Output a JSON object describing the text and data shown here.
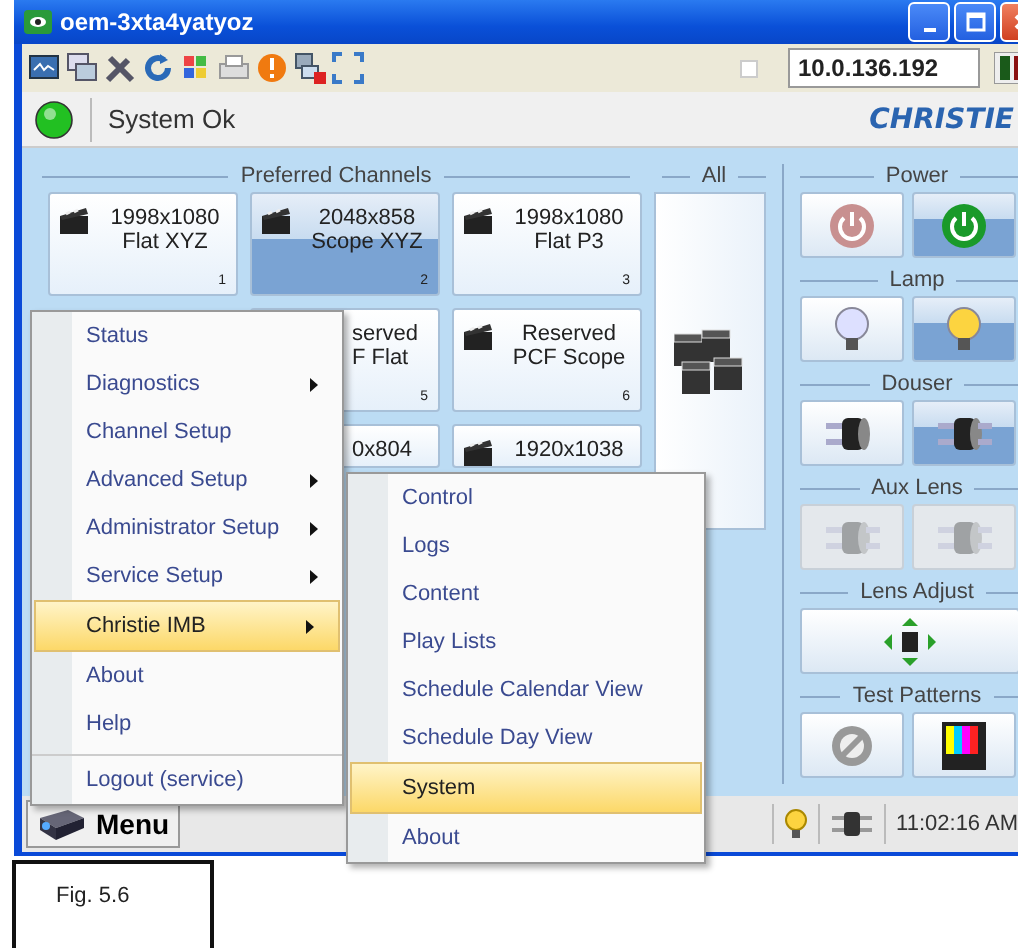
{
  "window": {
    "title": "oem-3xta4yatyoz"
  },
  "toolbar": {
    "address": "10.0.136.192",
    "checked": false
  },
  "status": {
    "text": "System Ok",
    "ok": true,
    "logo": "CHRISTIE"
  },
  "preferred_channels": {
    "title": "Preferred Channels",
    "rows": [
      [
        {
          "resolution": "1998x1080",
          "format": "Flat XYZ",
          "number": "1",
          "selected": false,
          "covered": false
        },
        {
          "resolution": "2048x858",
          "format": "Scope XYZ",
          "number": "2",
          "selected": true,
          "covered": false
        },
        {
          "resolution": "1998x1080",
          "format": "Flat P3",
          "number": "3",
          "selected": false,
          "covered": false
        }
      ],
      [
        "",
        {
          "resolution": "served",
          "format": "F Flat",
          "number": "5",
          "selected": false,
          "covered": true
        },
        {
          "resolution": "Reserved",
          "format": "PCF Scope",
          "number": "6",
          "selected": false,
          "covered": false
        }
      ],
      [
        "",
        {
          "resolution": "0x804",
          "selected": false,
          "covered": true
        },
        {
          "resolution": "1920x1038",
          "selected": false,
          "covered": false
        }
      ]
    ]
  },
  "all": {
    "title": "All"
  },
  "controls": [
    {
      "title": "Power",
      "buttons": [
        {
          "kind": "power-off",
          "selected": false,
          "disabled": false
        },
        {
          "kind": "power-on",
          "selected": true,
          "disabled": false
        }
      ]
    },
    {
      "title": "Lamp",
      "buttons": [
        {
          "kind": "bulb-off",
          "selected": false,
          "disabled": false
        },
        {
          "kind": "bulb-on",
          "selected": true,
          "disabled": false
        }
      ]
    },
    {
      "title": "Douser",
      "buttons": [
        {
          "kind": "douser-closed",
          "selected": false,
          "disabled": false
        },
        {
          "kind": "douser-open",
          "selected": true,
          "disabled": false
        }
      ]
    },
    {
      "title": "Aux Lens",
      "buttons": [
        {
          "kind": "lens-in",
          "selected": false,
          "disabled": true
        },
        {
          "kind": "lens-out",
          "selected": false,
          "disabled": true
        }
      ]
    },
    {
      "title": "Lens Adjust",
      "buttons": [
        {
          "kind": "lens-adjust",
          "selected": false,
          "disabled": false
        }
      ]
    },
    {
      "title": "Test Patterns",
      "buttons": [
        {
          "kind": "pattern-off",
          "selected": false,
          "disabled": false
        },
        {
          "kind": "pattern-bars",
          "selected": false,
          "disabled": false
        }
      ]
    }
  ],
  "bottom_bar": {
    "menu_label": "Menu",
    "time": "11:02:16 AM"
  },
  "menu": {
    "items": [
      {
        "label": "Status",
        "submenu": false,
        "selected": false,
        "separator_before": false
      },
      {
        "label": "Diagnostics",
        "submenu": true,
        "selected": false,
        "separator_before": false
      },
      {
        "label": "Channel Setup",
        "submenu": false,
        "selected": false,
        "separator_before": false
      },
      {
        "label": "Advanced Setup",
        "submenu": true,
        "selected": false,
        "separator_before": false
      },
      {
        "label": "Administrator Setup",
        "submenu": true,
        "selected": false,
        "separator_before": false
      },
      {
        "label": "Service Setup",
        "submenu": true,
        "selected": false,
        "separator_before": false
      },
      {
        "label": "Christie IMB",
        "submenu": true,
        "selected": true,
        "separator_before": false
      },
      {
        "label": "About",
        "submenu": false,
        "selected": false,
        "separator_before": false
      },
      {
        "label": "Help",
        "submenu": false,
        "selected": false,
        "separator_before": false
      },
      {
        "label": "Logout (service)",
        "submenu": false,
        "selected": false,
        "separator_before": true
      }
    ]
  },
  "submenu": {
    "items": [
      {
        "label": "Control",
        "selected": false
      },
      {
        "label": "Logs",
        "selected": false
      },
      {
        "label": "Content",
        "selected": false
      },
      {
        "label": "Play Lists",
        "selected": false
      },
      {
        "label": "Schedule Calendar View",
        "selected": false
      },
      {
        "label": "Schedule Day View",
        "selected": false
      },
      {
        "label": "System",
        "selected": true
      },
      {
        "label": "About",
        "selected": false
      }
    ]
  },
  "caption": "Fig. 5.6"
}
